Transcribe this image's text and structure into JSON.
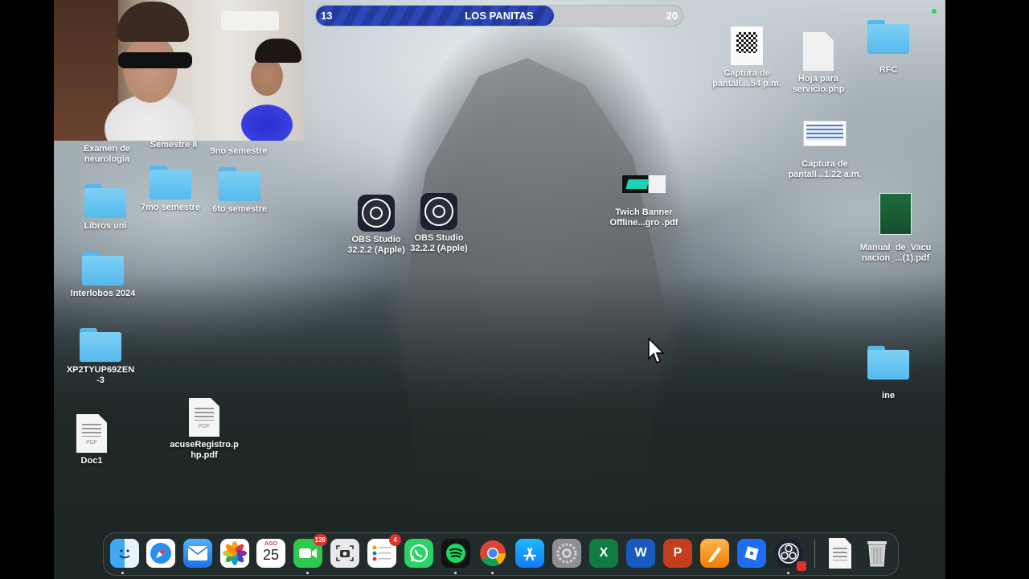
{
  "overlay": {
    "score_left": "13",
    "score_title": "LOS PANITAS",
    "score_right": "20",
    "score_fill_fraction": 0.65
  },
  "desktop_icons": {
    "examen": "Examen de\nneurologia",
    "semestre8": "Semestre 8",
    "noveno": "9no semestre",
    "septimo": "7mo semestre",
    "sexto": "6to semestre",
    "libros": "Libros uni",
    "interlobos": "Interlobos 2024",
    "xp2": "XP2TYUP69ZEN\n-3",
    "doc1": "Doc1",
    "acuse": "acuseRegistro.p\nhp.pdf",
    "obs1": "OBS Studio\n32.2.2 (Apple)",
    "obs2": "OBS Studio\n32.2.2 (Apple)",
    "twich": "Twich Banner\nOffline...gro .pdf",
    "captura1": "Captura de\npantall....54 p.m.",
    "hoja": "Hoja para\nservicio.php",
    "rfc": "RFC",
    "captura2": "Captura de\npantall...1.22 a.m.",
    "manual": "Manual_de_Vacu\nnacion_...(1).pdf",
    "ine": "ine"
  },
  "doc_tag": "PDF",
  "dock": {
    "calendar_month": "AGO",
    "calendar_day": "25",
    "facetime_badge": "126",
    "reminders_badge": "4",
    "excel_letter": "X",
    "word_letter": "W",
    "powerpoint_letter": "P",
    "apps": [
      "finder",
      "safari",
      "mail",
      "photos",
      "calendar",
      "facetime",
      "screenshot",
      "reminders",
      "whatsapp",
      "spotify",
      "chrome",
      "app-store",
      "system-settings",
      "excel",
      "word",
      "powerpoint",
      "pages",
      "roblox",
      "obs"
    ]
  },
  "colors": {
    "score_bar": "#233a9c",
    "folder": "#6ec6f2",
    "badge": "#e5302b"
  }
}
